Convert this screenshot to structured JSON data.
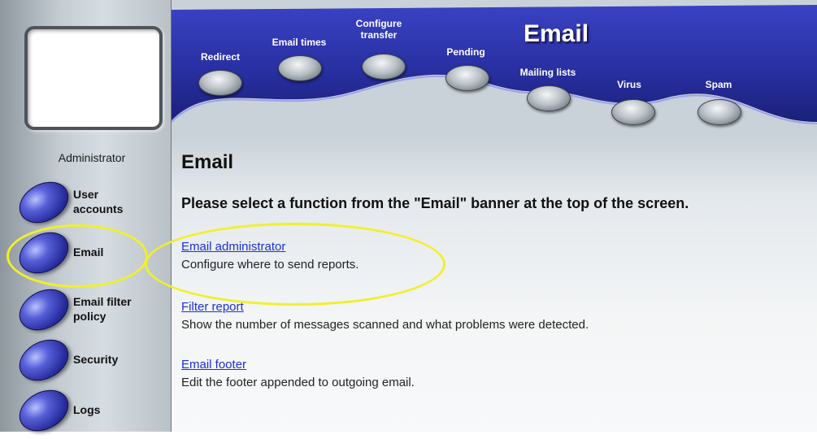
{
  "sidebar": {
    "user_role": "Administrator",
    "items": [
      {
        "label": "User\naccounts"
      },
      {
        "label": "Email"
      },
      {
        "label": "Email filter\npolicy"
      },
      {
        "label": "Security"
      },
      {
        "label": "Logs"
      }
    ]
  },
  "banner": {
    "title": "Email",
    "buttons": [
      {
        "label": "Redirect"
      },
      {
        "label": "Email times"
      },
      {
        "label": "Configure\ntransfer"
      },
      {
        "label": "Pending"
      },
      {
        "label": "Mailing lists"
      },
      {
        "label": "Virus"
      },
      {
        "label": "Spam"
      }
    ]
  },
  "main": {
    "heading": "Email",
    "instruction": "Please select a function from the \"Email\" banner at the top of the screen.",
    "links": [
      {
        "title": "Email administrator",
        "description": "Configure where to send reports."
      },
      {
        "title": "Filter report",
        "description": "Show the number of messages scanned and what problems were detected."
      },
      {
        "title": "Email footer",
        "description": "Edit the footer appended to outgoing email."
      }
    ]
  },
  "colors": {
    "banner_blue": "#272e9e",
    "link_blue": "#1c2fd6",
    "highlight_yellow": "#f2ef2a"
  }
}
